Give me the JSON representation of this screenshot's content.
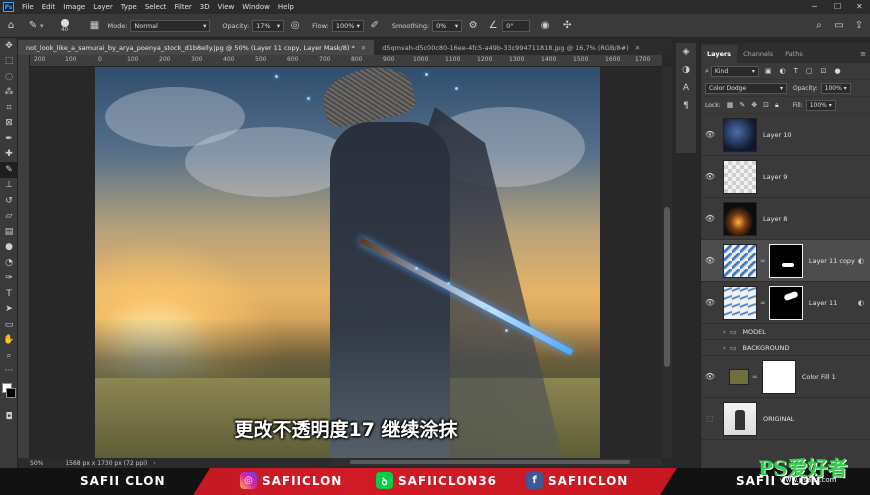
{
  "menubar": {
    "app_icon": "Ps",
    "items": [
      "File",
      "Edit",
      "Image",
      "Layer",
      "Type",
      "Select",
      "Filter",
      "3D",
      "View",
      "Window",
      "Help"
    ]
  },
  "options": {
    "brush_size": "40",
    "mode_label": "Mode:",
    "mode_value": "Normal",
    "opacity_label": "Opacity:",
    "opacity_value": "17%",
    "flow_label": "Flow:",
    "flow_value": "100%",
    "smoothing_label": "Smoothing:",
    "smoothing_value": "0%",
    "angle_value": "0°"
  },
  "tabs": [
    {
      "label": "not_look_like_a_samurai_by_arya_poenya_stock_d1b8elly.jpg @ 50% (Layer 11 copy, Layer Mask/8) *"
    },
    {
      "label": "d5qmvah-d5c00c80-16ee-4fc5-a49b-33c994711818.jpg @ 16,7% (RGB/8#)"
    }
  ],
  "ruler_ticks": [
    "200",
    "100",
    "0",
    "100",
    "200",
    "300",
    "400",
    "500",
    "600",
    "700",
    "800",
    "900",
    "1000",
    "1100",
    "1200",
    "1300",
    "1400",
    "1500",
    "1600",
    "1700"
  ],
  "subtitle": "更改不透明度17 继续涂抹",
  "status": {
    "zoom": "50%",
    "dimensions": "1568 px x 1730 px (72 ppi)"
  },
  "layers_panel": {
    "tabs": [
      "Layers",
      "Channels",
      "Paths"
    ],
    "kind_label": "Kind",
    "blend_mode": "Color Dodge",
    "opacity_label": "Opacity:",
    "opacity_value": "100%",
    "lock_label": "Lock:",
    "fill_label": "Fill:",
    "fill_value": "100%",
    "layers": [
      {
        "name": "Layer 10"
      },
      {
        "name": "Layer 9"
      },
      {
        "name": "Layer 8"
      },
      {
        "name": "Layer 11 copy"
      },
      {
        "name": "Layer 11"
      }
    ],
    "groups": [
      {
        "name": "MODEL"
      },
      {
        "name": "BACKGROUND"
      }
    ],
    "bottom_layers": [
      {
        "name": "Color Fill 1"
      },
      {
        "name": "ORIGINAL"
      }
    ],
    "colors": {
      "fill_swatch": "#6e6f3c",
      "selected_row": "#4d4d4d"
    }
  },
  "banner": {
    "left_name": "SAFII CLON",
    "instagram": "SAFIICLON",
    "deviant": "SAFIICLON36",
    "facebook": "SAFIICLON",
    "right_name": "SAFII CLON",
    "watermark": "PS爱好者",
    "watermark_url": "www.psahz.com",
    "brand_color": "#d11b27"
  }
}
